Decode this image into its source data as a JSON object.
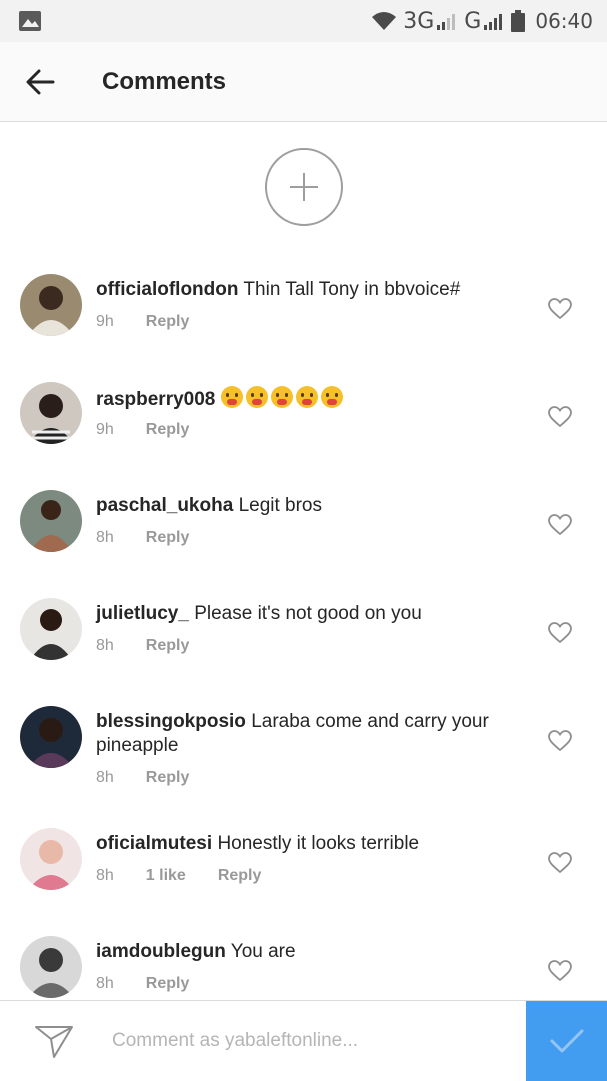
{
  "status_bar": {
    "network_1": "3G",
    "network_2": "G",
    "time": "06:40"
  },
  "header": {
    "title": "Comments"
  },
  "comments": [
    {
      "username": "officialoflondon",
      "text": "Thin Tall Tony in bbvoice#",
      "time": "9h",
      "likes": "",
      "reply": "Reply",
      "avatar_color": "#7a6a55"
    },
    {
      "username": "raspberry008",
      "text": "",
      "emoji_count": 5,
      "time": "9h",
      "likes": "",
      "reply": "Reply",
      "avatar_color": "#3a3030"
    },
    {
      "username": "paschal_ukoha",
      "text": "Legit bros",
      "time": "8h",
      "likes": "",
      "reply": "Reply",
      "avatar_color": "#6b5040"
    },
    {
      "username": "julietlucy_",
      "text": "Please it's not good on you",
      "time": "8h",
      "likes": "",
      "reply": "Reply",
      "avatar_color": "#4a3a35"
    },
    {
      "username": "blessingokposio",
      "text": "Laraba come and carry your pineapple",
      "time": "8h",
      "likes": "",
      "reply": "Reply",
      "avatar_color": "#2e2a3a"
    },
    {
      "username": "oficialmutesi",
      "text": "Honestly it looks terrible",
      "time": "8h",
      "likes": "1 like",
      "reply": "Reply",
      "avatar_color": "#d89a98"
    },
    {
      "username": "iamdoublegun",
      "text": "You are",
      "time": "8h",
      "likes": "",
      "reply": "Reply",
      "avatar_color": "#9a9a9a"
    }
  ],
  "composer": {
    "placeholder": "Comment as yabaleftonline..."
  },
  "colors": {
    "accent": "#3897f0",
    "meta_gray": "#999999",
    "text": "#262626"
  }
}
